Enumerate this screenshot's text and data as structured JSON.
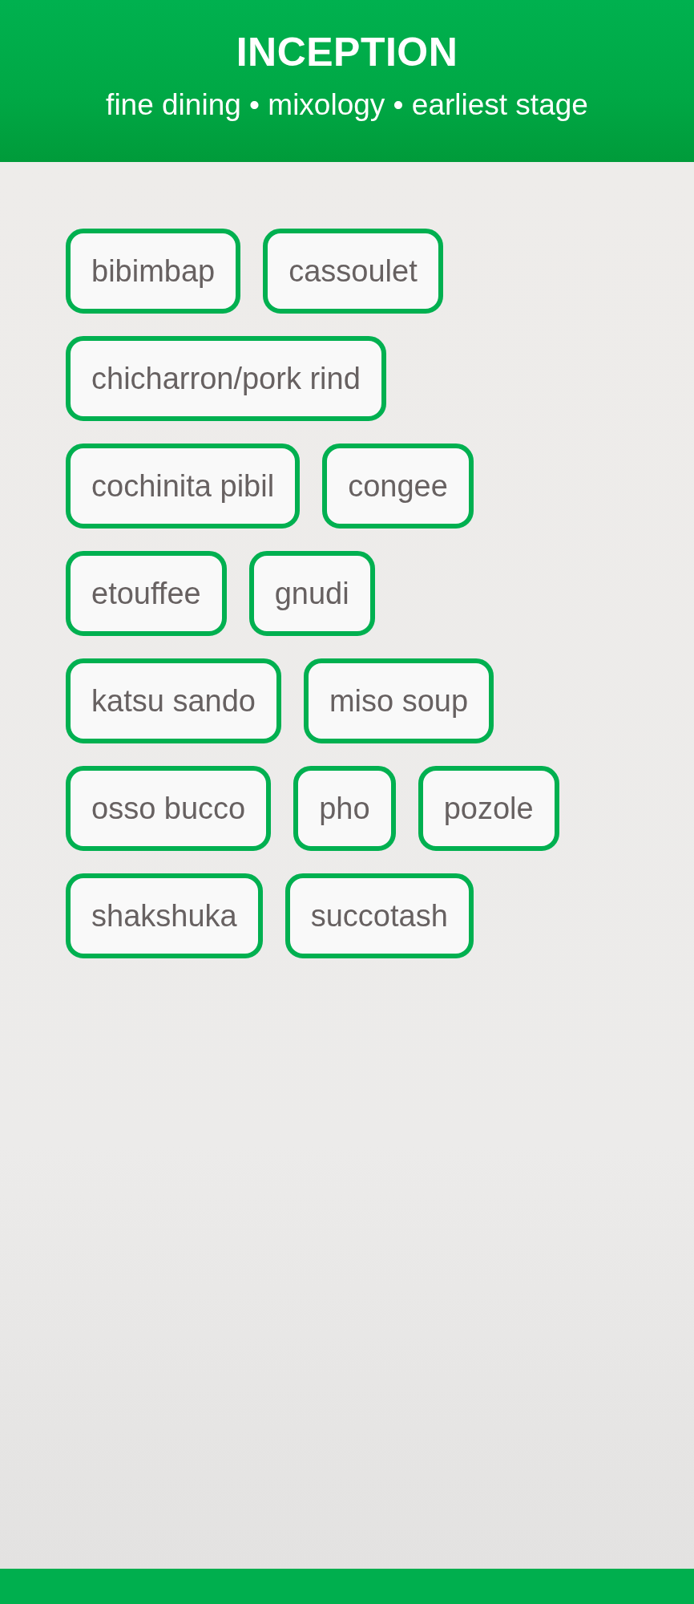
{
  "header": {
    "title": "INCEPTION",
    "subtitle": "fine dining • mixology • earliest stage"
  },
  "dishes": [
    {
      "label": "bibimbap"
    },
    {
      "label": "cassoulet"
    },
    {
      "label": "chicharron/pork rind"
    },
    {
      "label": "cochinita pibil"
    },
    {
      "label": "congee"
    },
    {
      "label": "etouffee"
    },
    {
      "label": "gnudi"
    },
    {
      "label": "katsu sando"
    },
    {
      "label": "miso soup"
    },
    {
      "label": "osso bucco"
    },
    {
      "label": "pho"
    },
    {
      "label": "pozole"
    },
    {
      "label": "shakshuka"
    },
    {
      "label": "succotash"
    }
  ]
}
